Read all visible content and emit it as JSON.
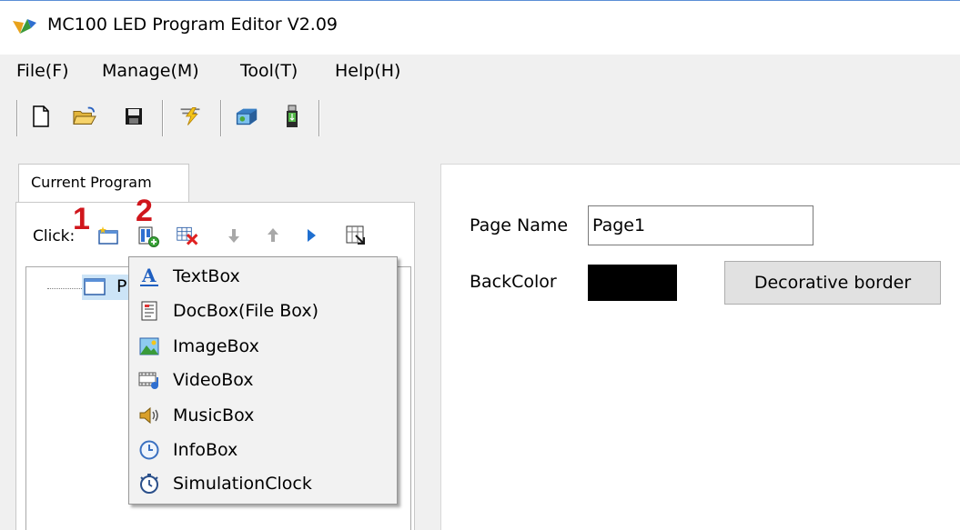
{
  "window": {
    "title": "MC100 LED Program Editor V2.09"
  },
  "menu": [
    "File(F)",
    "Manage(M)",
    "Tool(T)",
    "Help(H)"
  ],
  "toolbar_icons": [
    "new-file-icon",
    "open-folder-icon",
    "save-icon",
    "send-icon",
    "display-screen-icon",
    "usb-drive-icon"
  ],
  "tab": {
    "label": "Current Program"
  },
  "program_toolbar": {
    "click_label": "Click:",
    "callout_1": "1",
    "callout_2": "2",
    "icons": [
      "add-page-icon",
      "add-item-icon",
      "delete-icon",
      "move-down-icon",
      "move-up-icon",
      "play-icon",
      "preview-icon"
    ]
  },
  "tree": {
    "node_label": "P"
  },
  "dropdown": {
    "items": [
      {
        "label": "TextBox",
        "icon": "text-icon"
      },
      {
        "label": "DocBox(File Box)",
        "icon": "document-icon"
      },
      {
        "label": "ImageBox",
        "icon": "image-icon"
      },
      {
        "label": "VideoBox",
        "icon": "video-icon"
      },
      {
        "label": "MusicBox",
        "icon": "speaker-icon"
      },
      {
        "label": "InfoBox",
        "icon": "clock-info-icon"
      },
      {
        "label": "SimulationClock",
        "icon": "stopwatch-icon"
      }
    ]
  },
  "page_props": {
    "page_name_label": "Page Name",
    "page_name_value": "Page1",
    "back_color_label": "BackColor",
    "back_color": "#000000",
    "decorative_border_label": "Decorative border"
  },
  "colors": {
    "callout": "#d0161c",
    "accent": "#1f6fd0"
  }
}
